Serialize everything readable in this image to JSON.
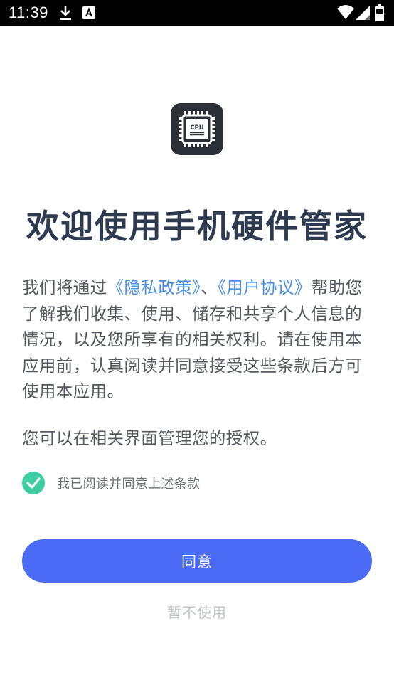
{
  "status_bar": {
    "time": "11:39",
    "icons": [
      "download-icon",
      "font-a-icon",
      "wifi-icon",
      "signal-icon",
      "battery-icon"
    ]
  },
  "app_icon": {
    "name": "cpu-chip-icon",
    "chip_text": "CPU"
  },
  "title": "欢迎使用手机硬件管家",
  "intro": {
    "prefix": "我们将通过",
    "privacy_link": "《隐私政策》",
    "separator": "、",
    "terms_link": "《用户协议》",
    "suffix": "帮助您了解我们收集、使用、储存和共享个人信息的情况，以及您所享有的相关权利。请在使用本应用前，认真阅读并同意接受这些条款后方可使用本应用。"
  },
  "manage_text": "您可以在相关界面管理您的授权。",
  "consent": {
    "checked": true,
    "label": "我已阅读并同意上述条款"
  },
  "buttons": {
    "agree": "同意",
    "decline": "暂不使用"
  },
  "colors": {
    "primary": "#4b6af5",
    "check": "#3ecda2",
    "link": "#4a90e2",
    "title": "#2e3a4f"
  }
}
